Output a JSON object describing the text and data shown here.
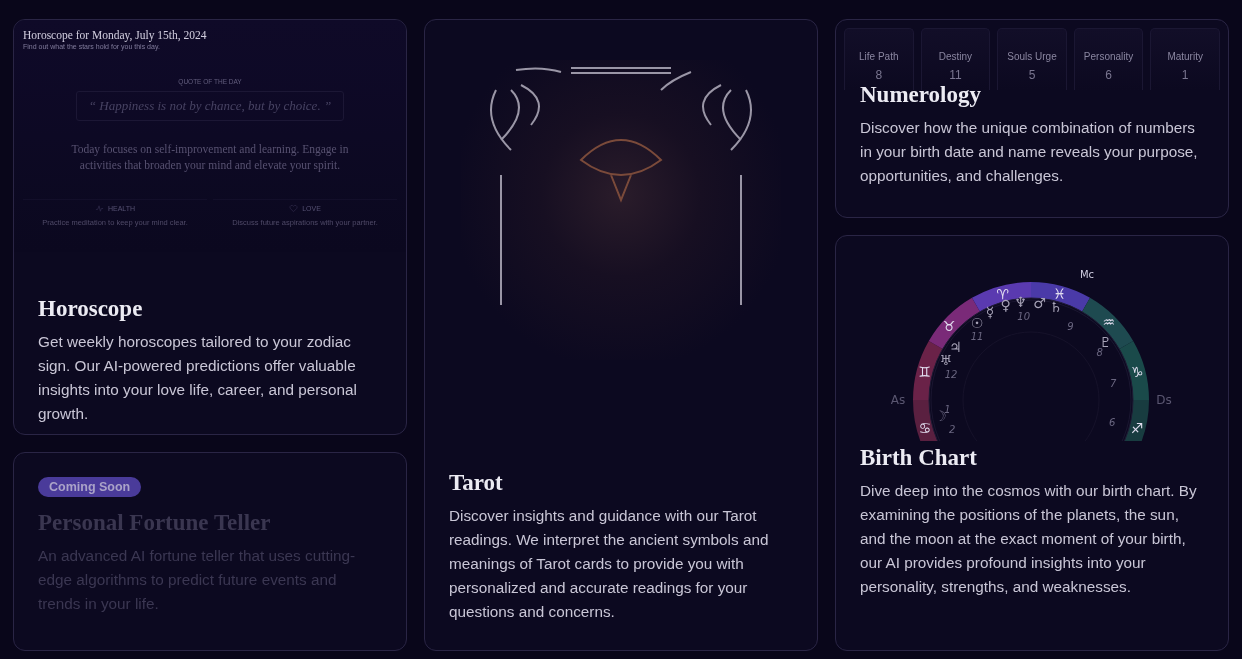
{
  "horoscope": {
    "preview": {
      "title": "Horoscope for Monday, July 15th, 2024",
      "subtitle": "Find out what the stars hold for you this day.",
      "quote_label": "QUOTE OF THE DAY",
      "quote": "“ Happiness is not by chance, but by choice. ”",
      "summary": "Today focuses on self-improvement and learning. Engage in activities that broaden your mind and elevate your spirit.",
      "areas": [
        {
          "kind": "health",
          "label": "HEALTH",
          "text": "Practice meditation to keep your mind clear."
        },
        {
          "kind": "love",
          "label": "LOVE",
          "text": "Discuss future aspirations with your partner."
        }
      ]
    },
    "title": "Horoscope",
    "description": "Get weekly horoscopes tailored to your zodiac sign. Our AI-powered predictions offer valuable insights into your love life, career, and personal growth."
  },
  "fortune_teller": {
    "badge": "Coming Soon",
    "title": "Personal Fortune Teller",
    "description": "An advanced AI fortune teller that uses cutting-edge algorithms to predict future events and trends in your life.",
    "disabled": true
  },
  "tarot": {
    "title": "Tarot",
    "description": "Discover insights and guidance with our Tarot readings. We interpret the ancient symbols and meanings of Tarot cards to provide you with personalized and accurate readings for your questions and concerns."
  },
  "numerology": {
    "numbers": [
      {
        "label": "Life Path",
        "value": "8"
      },
      {
        "label": "Destiny",
        "value": "11"
      },
      {
        "label": "Souls Urge",
        "value": "5"
      },
      {
        "label": "Personality",
        "value": "6"
      },
      {
        "label": "Maturity",
        "value": "1"
      }
    ],
    "title": "Numerology",
    "description": "Discover how the unique combination of numbers in your birth date and name reveals your purpose, opportunities, and challenges."
  },
  "birth_chart": {
    "wheel": {
      "axis_labels": [
        "Mc",
        "As",
        "Ds"
      ],
      "signs": [
        "♋",
        "♊",
        "♉",
        "♈",
        "♓",
        "♒",
        "♑",
        "♐"
      ],
      "houses": [
        "1",
        "2",
        "12",
        "11",
        "10",
        "9",
        "8",
        "7",
        "6"
      ],
      "planets": [
        "☉",
        "☿",
        "♀",
        "♆",
        "♂",
        "♄",
        "♃",
        "♅",
        "♇",
        "☽"
      ]
    },
    "title": "Birth Chart",
    "description": "Dive deep into the cosmos with our birth chart. By examining the positions of the planets, the sun, and the moon at the exact moment of your birth, our AI provides profound insights into your personality, strengths, and weaknesses."
  }
}
